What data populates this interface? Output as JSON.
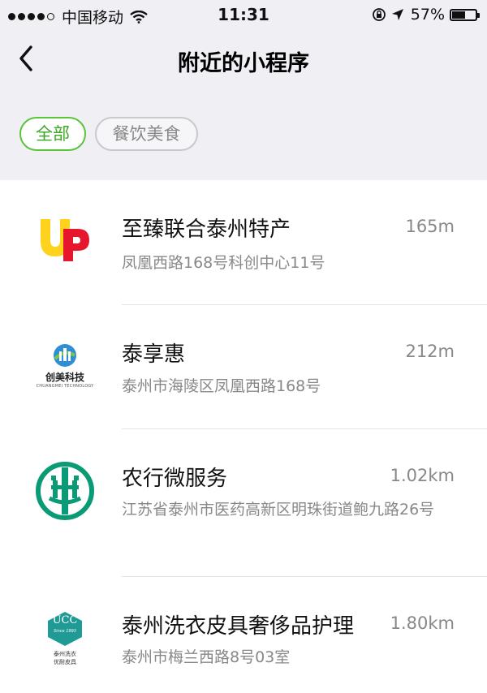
{
  "status_bar": {
    "carrier": "中国移动",
    "time": "11:31",
    "battery_percent": "57%",
    "battery_level": 0.57
  },
  "nav": {
    "title": "附近的小程序",
    "back_icon": "chevron-left-icon"
  },
  "filters": [
    {
      "label": "全部",
      "active": true
    },
    {
      "label": "餐饮美食",
      "active": false
    }
  ],
  "items": [
    {
      "name": "至臻联合泰州特产",
      "distance": "165m",
      "address": "凤凰西路168号科创中心11号",
      "logo": "up-logo"
    },
    {
      "name": "泰享惠",
      "distance": "212m",
      "address": "泰州市海陵区凤凰西路168号",
      "logo": "chuangmei-logo",
      "logo_text": "创美科技",
      "logo_subtext": "CHUANGMEI TECHNOLOGY"
    },
    {
      "name": "农行微服务",
      "distance": "1.02km",
      "address": "江苏省泰州市医药高新区明珠街道鲍九路26号",
      "logo": "abc-bank-logo"
    },
    {
      "name": "泰州洗衣皮具奢侈品护理",
      "distance": "1.80km",
      "address": "泰州市梅兰西路8号03室",
      "logo": "ucc-logo",
      "logo_text": "UCC",
      "logo_since": "Since 1993",
      "logo_caption_1": "泰州洗衣",
      "logo_caption_2": "优耐皮具"
    }
  ],
  "colors": {
    "accent_green": "#3aa820",
    "header_bg": "#efeff4",
    "abc_green": "#0a9a76",
    "ucc_teal": "#1f9a95"
  }
}
